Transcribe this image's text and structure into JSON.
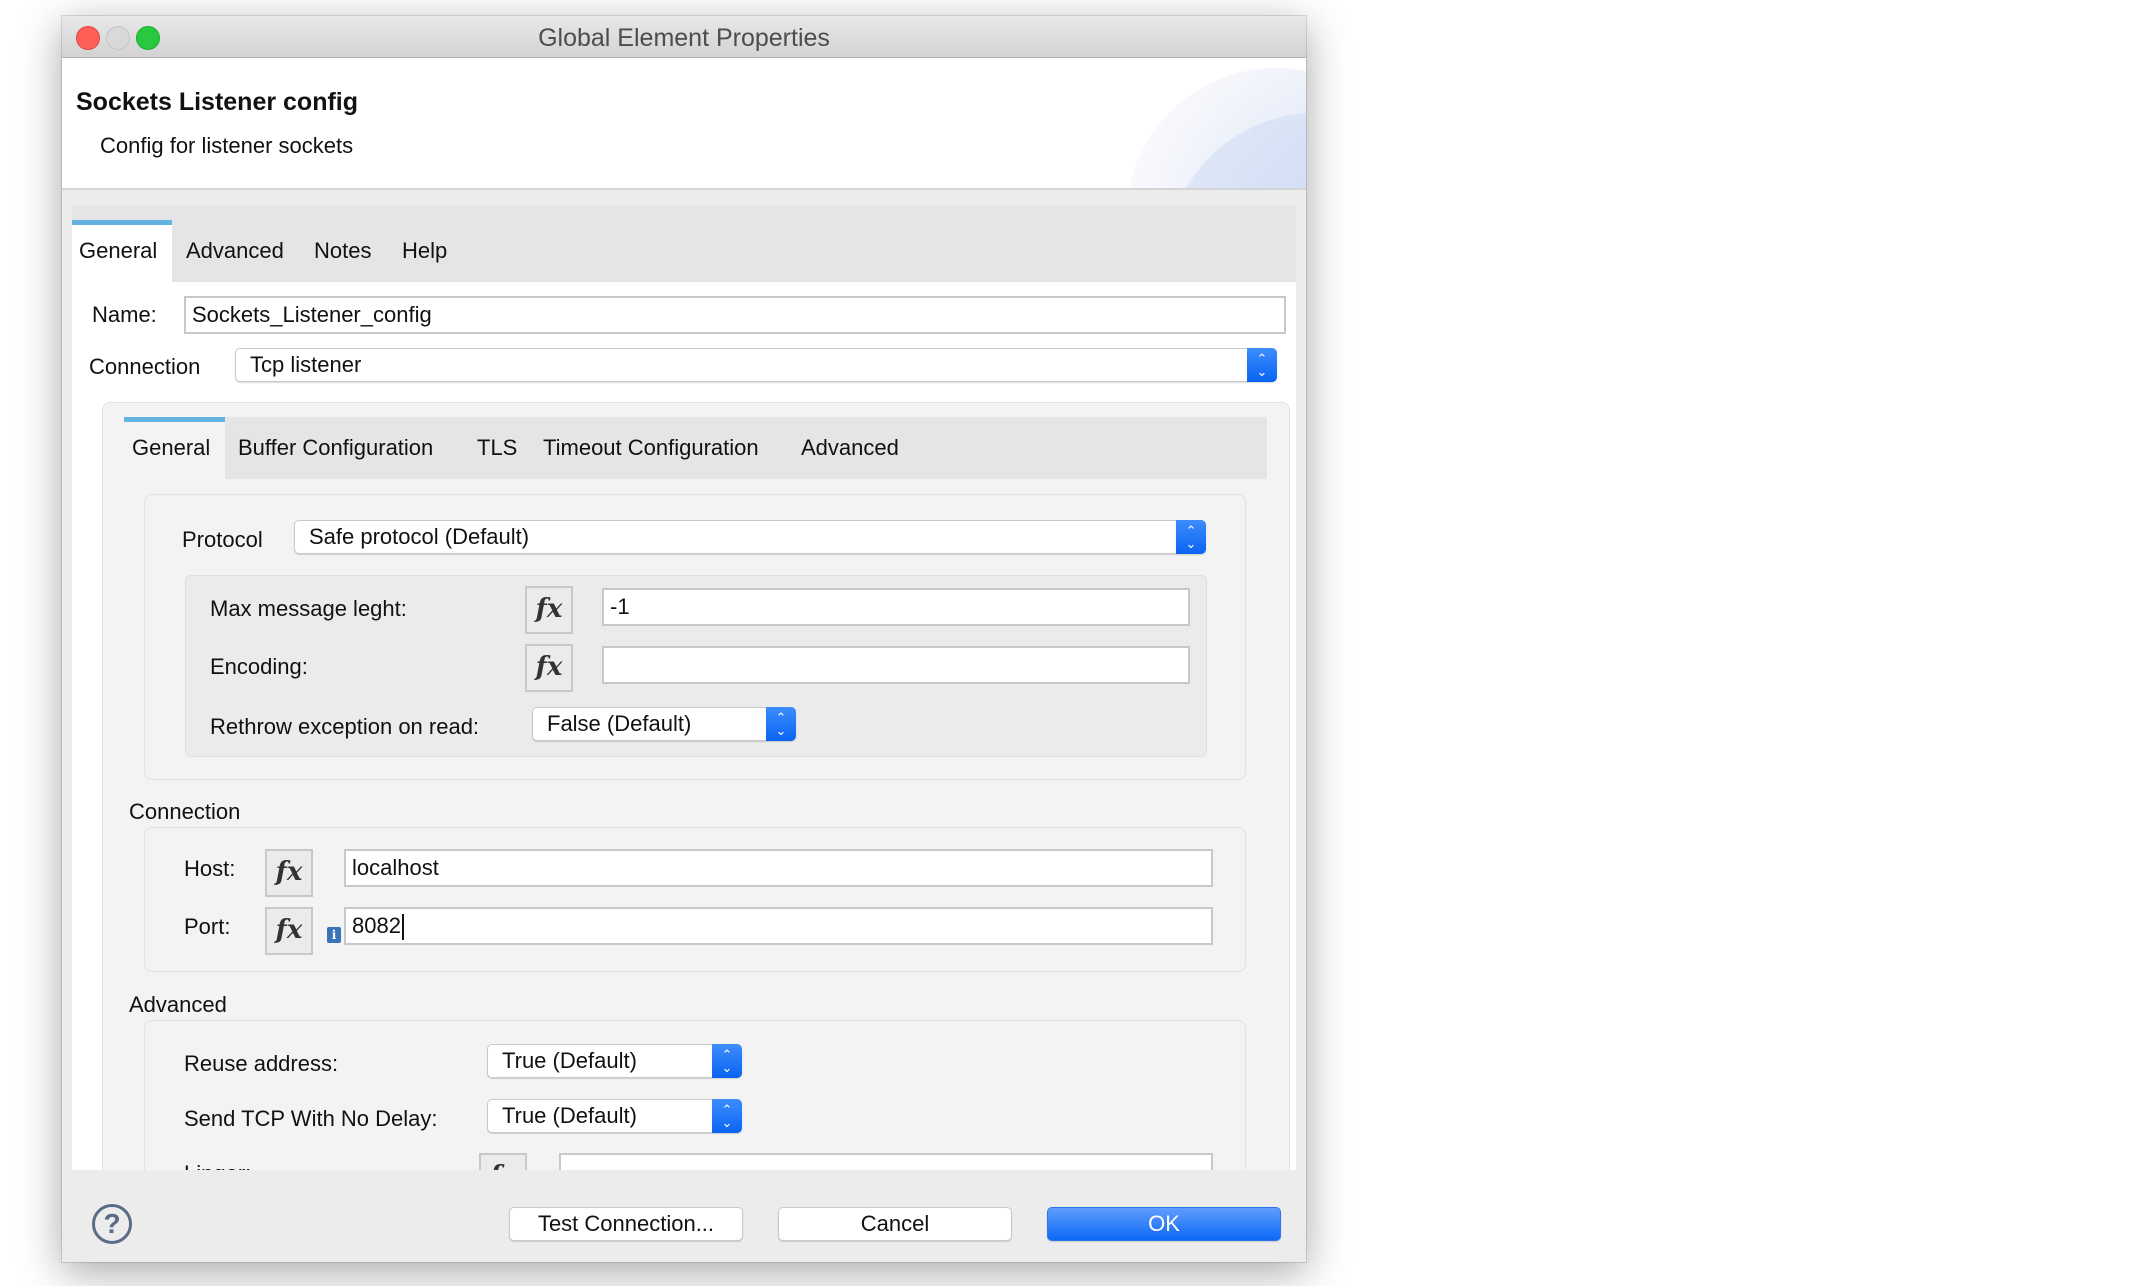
{
  "window": {
    "title": "Global Element Properties"
  },
  "header": {
    "title": "Sockets Listener config",
    "subtitle": "Config for listener sockets"
  },
  "outer_tabs": [
    {
      "label": "General",
      "active": true
    },
    {
      "label": "Advanced",
      "active": false
    },
    {
      "label": "Notes",
      "active": false
    },
    {
      "label": "Help",
      "active": false
    }
  ],
  "form": {
    "name_label": "Name:",
    "name_value": "Sockets_Listener_config",
    "connection_label": "Connection",
    "connection_value": "Tcp listener"
  },
  "inner_tabs": [
    {
      "label": "General",
      "active": true
    },
    {
      "label": "Buffer Configuration",
      "active": false
    },
    {
      "label": "TLS",
      "active": false
    },
    {
      "label": "Timeout Configuration",
      "active": false
    },
    {
      "label": "Advanced",
      "active": false
    }
  ],
  "protocol": {
    "label": "Protocol",
    "value": "Safe protocol (Default)",
    "max_length_label": "Max message leght:",
    "max_length_value": "-1",
    "encoding_label": "Encoding:",
    "encoding_value": "",
    "rethrow_label": "Rethrow exception on read:",
    "rethrow_value": "False (Default)"
  },
  "connection_section": {
    "title": "Connection",
    "host_label": "Host:",
    "host_value": "localhost",
    "port_label": "Port:",
    "port_value": "8082"
  },
  "advanced_section": {
    "title": "Advanced",
    "reuse_label": "Reuse address:",
    "reuse_value": "True (Default)",
    "nodelay_label": "Send TCP With No Delay:",
    "nodelay_value": "True (Default)",
    "linger_label": "Linger:",
    "linger_value": ""
  },
  "icons": {
    "fx": "fx",
    "info": "i",
    "help": "?",
    "arrows_up": "⌃",
    "arrows_down": "⌄"
  },
  "footer": {
    "test_connection": "Test Connection...",
    "cancel": "Cancel",
    "ok": "OK"
  },
  "colors": {
    "accent_tab": "#62b3df",
    "primary_button": "#0d68f5",
    "close": "#fe5f57",
    "maximize": "#28c840"
  }
}
